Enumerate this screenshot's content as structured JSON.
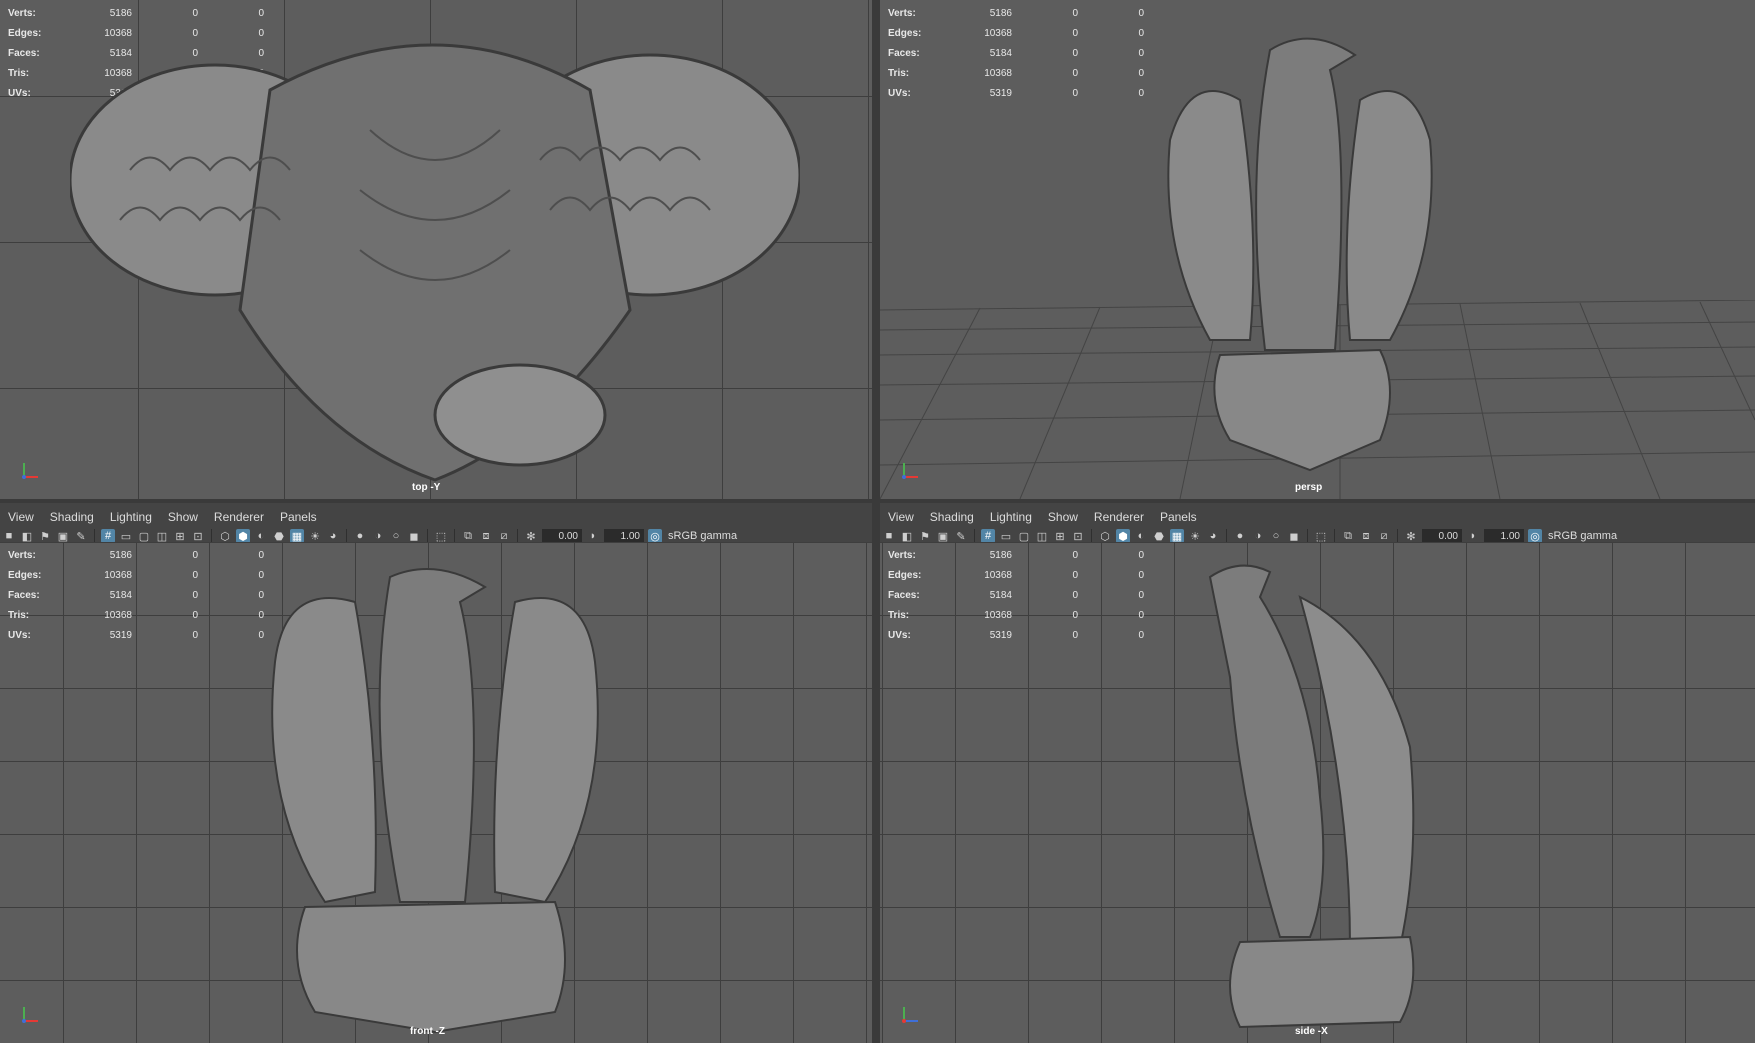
{
  "hud": {
    "labels": {
      "verts": "Verts:",
      "edges": "Edges:",
      "faces": "Faces:",
      "tris": "Tris:",
      "uvs": "UVs:"
    },
    "values": {
      "verts": "5186",
      "edges": "10368",
      "faces": "5184",
      "tris": "10368",
      "uvs": "5319"
    },
    "zero": "0"
  },
  "viewports": {
    "top": {
      "camera": "top -Y"
    },
    "persp": {
      "camera": "persp"
    },
    "front": {
      "camera": "front -Z"
    },
    "side": {
      "camera": "side -X"
    }
  },
  "panel_menu": [
    "View",
    "Shading",
    "Lighting",
    "Show",
    "Renderer",
    "Panels"
  ],
  "toolbar": {
    "exposure": "0.00",
    "gamma": "1.00",
    "colorspace": "sRGB gamma"
  },
  "colors": {
    "accent": "#5285a6",
    "viewport_bg": "#5d5d5d",
    "grid": "#3e3e3e"
  }
}
